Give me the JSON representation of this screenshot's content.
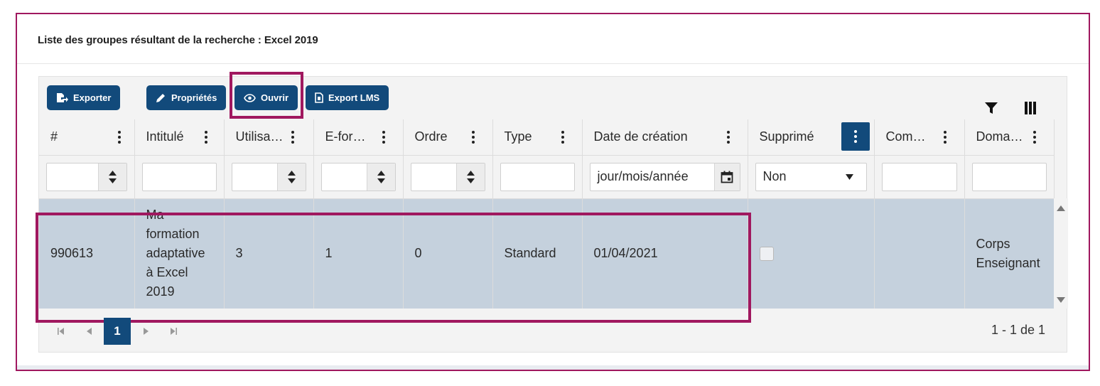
{
  "title": "Liste des groupes résultant de la recherche : Excel 2019",
  "toolbar": {
    "export_label": "Exporter",
    "properties_label": "Propriétés",
    "open_label": "Ouvrir",
    "export_lms_label": "Export LMS"
  },
  "columns": [
    "#",
    "Intitulé",
    "Utilisa…",
    "E-for…",
    "Ordre",
    "Type",
    "Date de création",
    "Supprimé",
    "Com…",
    "Doma…"
  ],
  "filters": {
    "date_placeholder": "jour/mois/année",
    "supprime_value": "Non"
  },
  "rows": [
    {
      "id": "990613",
      "intitule_lines": [
        "Ma",
        "formation",
        "adaptative",
        "à Excel",
        "2019"
      ],
      "utilisateurs": "3",
      "eformation": "1",
      "ordre": "0",
      "type": "Standard",
      "date_creation": "01/04/2021",
      "supprime_checked": false,
      "commentaire": "",
      "domaine_lines": [
        "Corps",
        "Enseignant"
      ]
    }
  ],
  "pager": {
    "current_page": "1",
    "info": "1 - 1 de 1"
  },
  "colors": {
    "accent": "#124a7b",
    "highlight": "#a0185f",
    "row_selected": "#c5d1dd"
  }
}
